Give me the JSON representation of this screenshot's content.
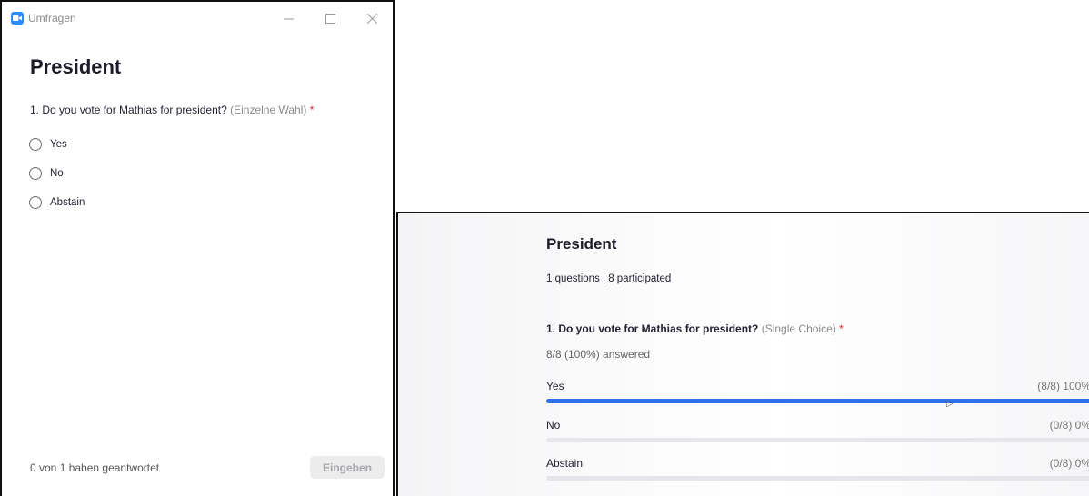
{
  "poll_window": {
    "title": "Umfragen",
    "heading": "President",
    "question": {
      "text": "1. Do you vote for Mathias for president?",
      "hint": "(Einzelne Wahl)",
      "required_mark": "*"
    },
    "options": [
      {
        "label": "Yes"
      },
      {
        "label": "No"
      },
      {
        "label": "Abstain"
      }
    ],
    "answered_status": "0 von 1 haben geantwortet",
    "submit_label": "Eingeben"
  },
  "results_panel": {
    "title": "President",
    "meta": "1 questions | 8 participated",
    "question": {
      "text": "1. Do you vote for Mathias for president?",
      "hint": "(Single Choice)",
      "required_mark": "*"
    },
    "answered": "8/8 (100%) answered",
    "rows": [
      {
        "label": "Yes",
        "value": "(8/8) 100%",
        "fraction": 1.0
      },
      {
        "label": "No",
        "value": "(0/8) 0%",
        "fraction": 0.0
      },
      {
        "label": "Abstain",
        "value": "(0/8) 0%",
        "fraction": 0.0
      }
    ]
  },
  "colors": {
    "accent": "#2d73e8",
    "app_icon": "#2d8cff",
    "required": "#e02828"
  }
}
